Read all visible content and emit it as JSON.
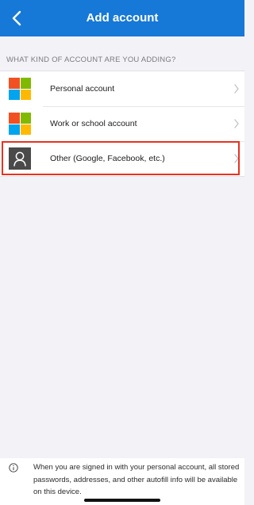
{
  "nav": {
    "title": "Add account",
    "back_icon": "chevron-left-icon"
  },
  "section": {
    "header": "WHAT KIND OF ACCOUNT ARE YOU ADDING?"
  },
  "accounts": [
    {
      "label": "Personal account",
      "icon": "microsoft-logo-icon"
    },
    {
      "label": "Work or school account",
      "icon": "microsoft-logo-icon"
    },
    {
      "label": "Other (Google, Facebook, etc.)",
      "icon": "person-icon",
      "highlighted": true
    }
  ],
  "footer": {
    "info_icon": "info-icon",
    "text": "When you are signed in with your personal account, all stored passwords, addresses, and other autofill info will be available on this device."
  },
  "colors": {
    "nav_background": "#1678d7",
    "highlight": "#e8321f",
    "page_background": "#f2f2f7"
  }
}
